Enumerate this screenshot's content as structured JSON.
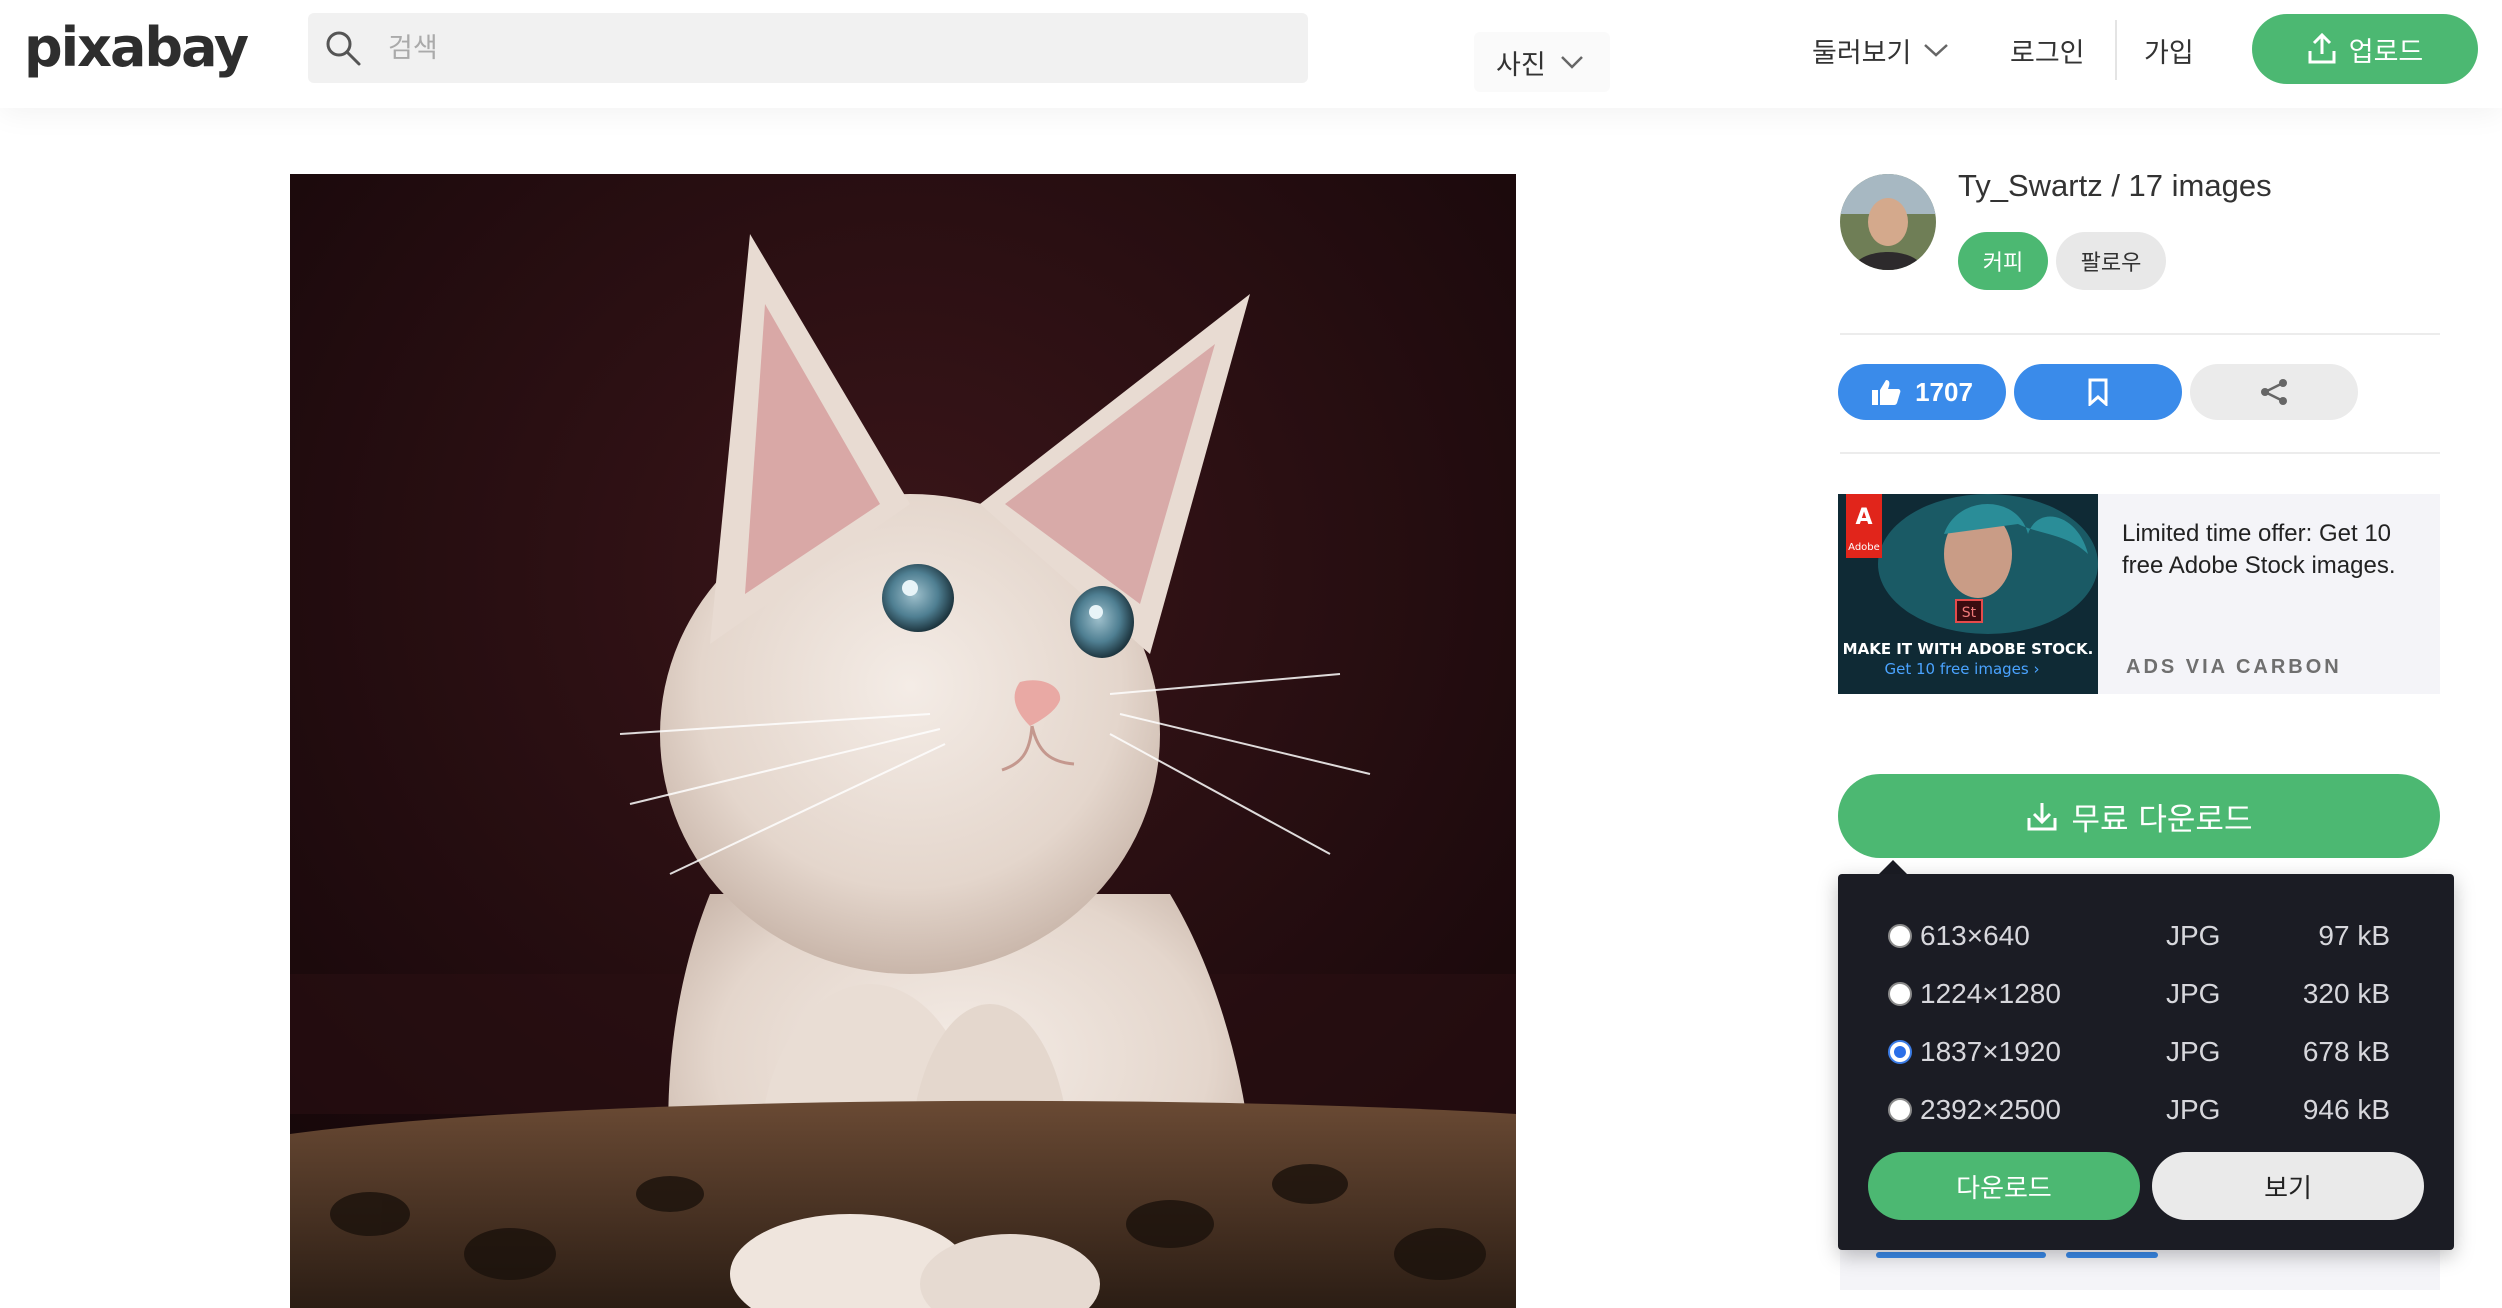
{
  "header": {
    "logo": "pixabay",
    "search_placeholder": "검색",
    "search_type": "사진",
    "nav": {
      "explore": "둘러보기",
      "login": "로그인",
      "join": "가입",
      "upload": "업로드"
    }
  },
  "author": {
    "name_line": "Ty_Swartz / 17 images",
    "coffee_label": "커피",
    "follow_label": "팔로우"
  },
  "actions": {
    "likes": "1707"
  },
  "ad": {
    "headline": "Limited time offer: Get 10 free Adobe Stock images.",
    "via": "ADS VIA CARBON",
    "banner_brand": "Adobe",
    "banner_badge": "St",
    "banner_line1": "MAKE IT WITH ADOBE STOCK.",
    "banner_line2": "Get 10 free images ›"
  },
  "download": {
    "main_label": "무료 다운로드",
    "options": [
      {
        "size": "613×640",
        "format": "JPG",
        "filesize": "97 kB",
        "selected": false
      },
      {
        "size": "1224×1280",
        "format": "JPG",
        "filesize": "320 kB",
        "selected": false
      },
      {
        "size": "1837×1920",
        "format": "JPG",
        "filesize": "678 kB",
        "selected": true
      },
      {
        "size": "2392×2500",
        "format": "JPG",
        "filesize": "946 kB",
        "selected": false
      }
    ],
    "download_label": "다운로드",
    "view_label": "보기"
  },
  "colors": {
    "green": "#4cb872",
    "blue": "#3a8bea",
    "popup_bg": "#1b1c24"
  }
}
